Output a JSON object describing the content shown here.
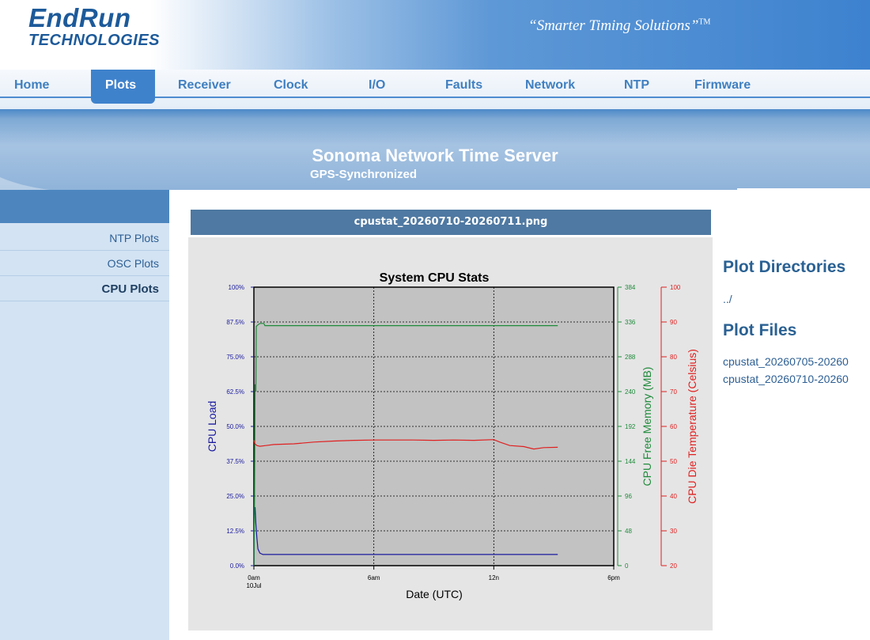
{
  "header": {
    "logo_top": "EndRun",
    "logo_bottom": "TECHNOLOGIES",
    "tagline": "“Smarter Timing Solutions”",
    "tagline_tm": "TM"
  },
  "nav": {
    "items": [
      "Home",
      "Plots",
      "Receiver",
      "Clock",
      "I/O",
      "Faults",
      "Network",
      "NTP",
      "Firmware"
    ],
    "active": "Plots"
  },
  "banner": {
    "title": "Sonoma Network Time Server",
    "subtitle": "GPS-Synchronized"
  },
  "sidebar": {
    "items": [
      {
        "label": "NTP Plots"
      },
      {
        "label": "OSC Plots"
      },
      {
        "label": "CPU Plots"
      }
    ],
    "active": "CPU Plots"
  },
  "plot": {
    "filename": "cpustat_20260710-20260711.png"
  },
  "right_panel": {
    "dirs_heading": "Plot Directories",
    "parent_link": "../",
    "files_heading": "Plot Files",
    "files": [
      "cpustat_20260705-20260",
      "cpustat_20260710-20260"
    ]
  },
  "chart_data": {
    "type": "line",
    "title": "System CPU Stats",
    "xlabel": "Date (UTC)",
    "x_ticks": [
      "0am",
      "6am",
      "12n",
      "6pm"
    ],
    "x_tick_sub": "10Jul",
    "x_range_hours": [
      0,
      18
    ],
    "left_axis": {
      "label": "CPU Load",
      "ticks": [
        "0.0%",
        "12.5%",
        "25.0%",
        "37.5%",
        "50.0%",
        "62.5%",
        "75.0%",
        "87.5%",
        "100%"
      ],
      "range": [
        0,
        100
      ],
      "color": "#1a1aa0"
    },
    "right_axis_1": {
      "label": "CPU Free Memory (MB)",
      "ticks": [
        "0",
        "48",
        "96",
        "144",
        "192",
        "240",
        "288",
        "336",
        "384"
      ],
      "range": [
        0,
        384
      ],
      "color": "#1e8a3a"
    },
    "right_axis_2": {
      "label": "CPU Die Temperature (Celsius)",
      "ticks": [
        "20",
        "30",
        "40",
        "50",
        "60",
        "70",
        "80",
        "90",
        "100"
      ],
      "range": [
        20,
        100
      ],
      "color": "#e02020"
    },
    "grid": true,
    "series": [
      {
        "axis": "left",
        "color": "#1a1aa0",
        "x": [
          0,
          0.02,
          0.06,
          0.1,
          0.15,
          0.2,
          0.3,
          0.45,
          0.6,
          1,
          3,
          6,
          9,
          12,
          15.2
        ],
        "y": [
          0,
          18,
          21,
          15,
          10,
          6,
          4.5,
          4,
          4,
          4,
          4,
          4,
          4,
          4,
          4
        ]
      },
      {
        "axis": "right_axis_1",
        "color": "#1e8a3a",
        "x": [
          0,
          0.03,
          0.06,
          0.1,
          0.12,
          0.2,
          0.3,
          0.5,
          0.55,
          1,
          3,
          6,
          9,
          12,
          15.2
        ],
        "y": [
          0,
          90,
          250,
          240,
          330,
          332,
          334,
          334,
          331,
          331,
          331,
          331,
          331,
          331,
          331
        ]
      },
      {
        "axis": "right_axis_2",
        "color": "#e02020",
        "x": [
          0,
          0.05,
          0.15,
          0.3,
          0.6,
          1,
          2,
          3,
          4,
          5,
          6,
          7,
          8,
          9,
          10,
          11,
          12,
          12.3,
          12.8,
          13.5,
          14,
          14.5,
          15.2
        ],
        "y": [
          56,
          55,
          54.5,
          54.3,
          54.5,
          54.8,
          55,
          55.5,
          55.8,
          56,
          56.1,
          56.1,
          56.1,
          56,
          56.1,
          56,
          56.2,
          55.5,
          54.5,
          54.2,
          53.5,
          53.9,
          54
        ]
      }
    ]
  }
}
